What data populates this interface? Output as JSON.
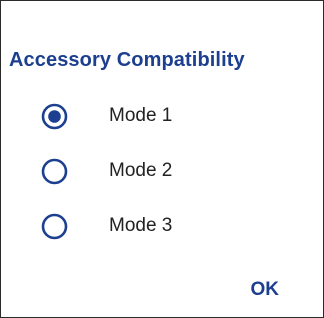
{
  "dialog": {
    "title": "Accessory Compatibility",
    "options": [
      {
        "label": "Mode 1",
        "selected": true
      },
      {
        "label": "Mode 2",
        "selected": false
      },
      {
        "label": "Mode 3",
        "selected": false
      }
    ],
    "ok_label": "OK"
  },
  "colors": {
    "accent": "#1c3f8f",
    "text": "#222222",
    "border": "#2b2b2b"
  }
}
